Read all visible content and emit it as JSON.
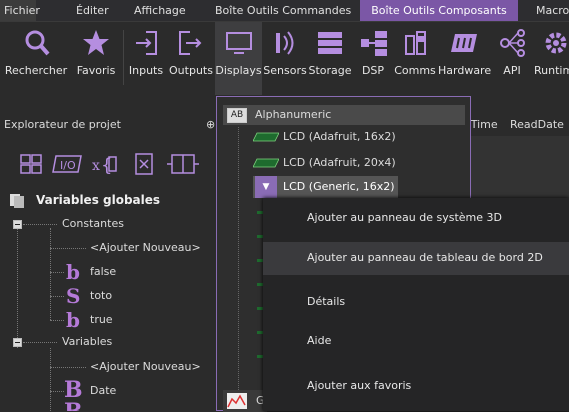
{
  "menu": {
    "tabs": [
      "Fichier",
      "Éditer",
      "Affichage",
      "Boîte Outils Commandes",
      "Boîte Outils Composants",
      "Macro"
    ]
  },
  "ribbon": {
    "items": [
      "Rechercher",
      "Favoris",
      "Inputs",
      "Outputs",
      "Displays",
      "Sensors",
      "Storage",
      "DSP",
      "Comms",
      "Hardware",
      "API",
      "Runtim"
    ],
    "icons": [
      "search-icon",
      "star-icon",
      "input-icon",
      "output-icon",
      "display-icon",
      "sensor-icon",
      "storage-icon",
      "dsp-icon",
      "comms-icon",
      "hardware-icon",
      "api-icon",
      "runtime-icon"
    ],
    "accent": "#7b57a6"
  },
  "project_explorer": {
    "title": "Explorateur de projet",
    "pin": "⊕",
    "tree": {
      "globals": "Variables globales",
      "constants": "Constantes",
      "add_new_1": "<Ajouter Nouveau>",
      "const_items": [
        {
          "glyph": "b",
          "label": "false"
        },
        {
          "glyph": "S",
          "label": "toto"
        },
        {
          "glyph": "b",
          "label": "true"
        }
      ],
      "variables": "Variables",
      "add_new_2": "<Ajouter Nouveau>",
      "var_items": [
        {
          "glyph": "B",
          "label": "Date"
        }
      ]
    }
  },
  "right_columns": [
    "/Time",
    "ReadDate"
  ],
  "dropdown": {
    "header": "Alphanumeric",
    "header_icon": "AB",
    "items": [
      "LCD (Adafruit, 16x2)",
      "LCD (Adafruit, 20x4)",
      "LCD (Generic, 16x2)"
    ],
    "footer_partial": "G"
  },
  "context_menu": {
    "items": [
      "Ajouter au panneau de système 3D",
      "Ajouter au panneau de tableau de bord 2D",
      "Détails",
      "Aide",
      "Ajouter aux favoris"
    ]
  }
}
